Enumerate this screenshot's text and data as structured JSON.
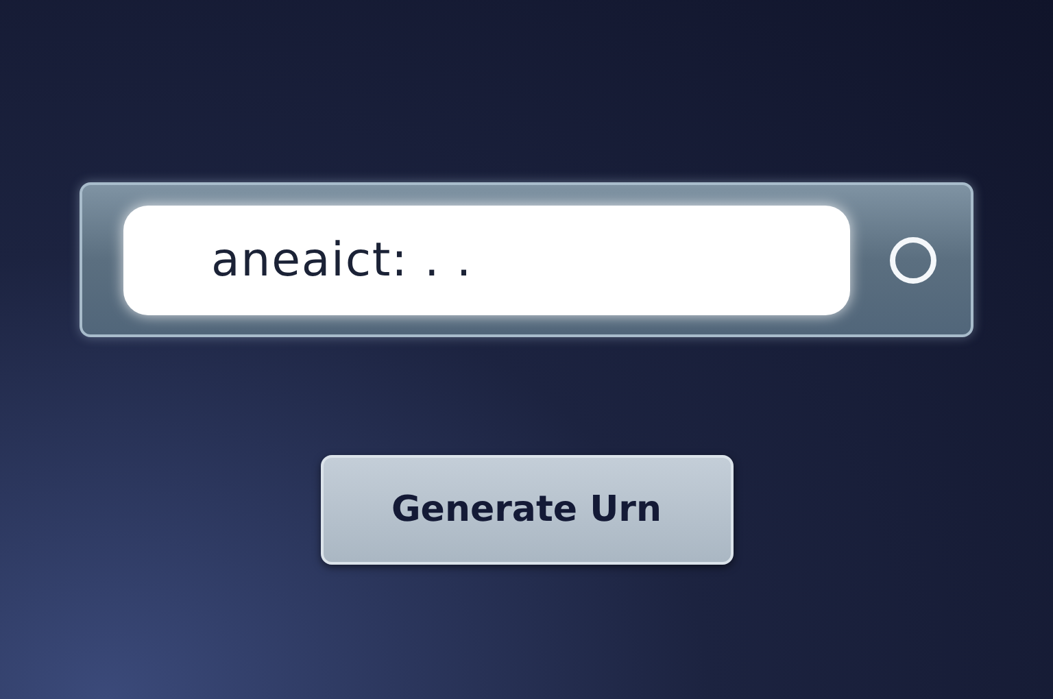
{
  "search_bar": {
    "value": "aneaict: . ."
  },
  "button": {
    "label": "Generate Urn"
  }
}
